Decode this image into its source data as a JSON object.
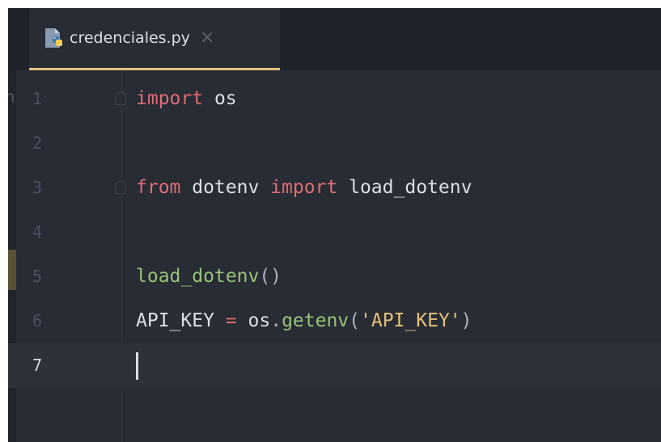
{
  "tab": {
    "filename": "credenciales.py",
    "close_glyph": "×",
    "file_icon": "python-file-icon",
    "active_indicator_color": "#e5c07b"
  },
  "gutter": {
    "edge_char": "h"
  },
  "lines": [
    {
      "number": "1",
      "tokens": [
        "import",
        " ",
        "os"
      ]
    },
    {
      "number": "2",
      "tokens": []
    },
    {
      "number": "3",
      "tokens": [
        "from",
        " dotenv ",
        "import",
        " load_dotenv"
      ]
    },
    {
      "number": "4",
      "tokens": []
    },
    {
      "number": "5",
      "tokens": [
        "load_dotenv",
        "()"
      ]
    },
    {
      "number": "6",
      "tokens": [
        "API_KEY",
        " ",
        "=",
        " os",
        ".",
        "getenv",
        "(",
        "'API_KEY'",
        ")"
      ]
    },
    {
      "number": "7",
      "tokens": []
    }
  ],
  "editor": {
    "current_line": "7",
    "theme_colors": {
      "background": "#282c34",
      "keyword": "#e06c75",
      "function": "#98c379",
      "string": "#e5c07b",
      "text": "#dcdfe4"
    }
  }
}
